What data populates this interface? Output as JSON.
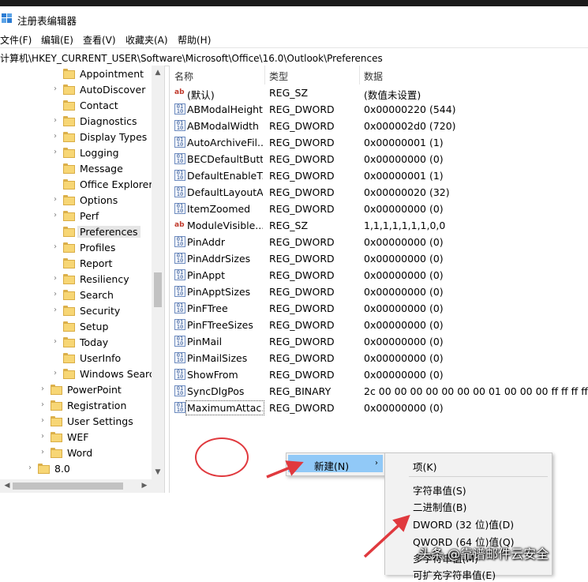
{
  "window": {
    "title": "注册表编辑器"
  },
  "menu": [
    "文件(F)",
    "编辑(E)",
    "查看(V)",
    "收藏夹(A)",
    "帮助(H)"
  ],
  "address": "计算机\\HKEY_CURRENT_USER\\Software\\Microsoft\\Office\\16.0\\Outlook\\Preferences",
  "tree": [
    {
      "label": "Appointment",
      "level": 2,
      "expandable": false
    },
    {
      "label": "AutoDiscover",
      "level": 2,
      "expandable": true
    },
    {
      "label": "Contact",
      "level": 2,
      "expandable": false
    },
    {
      "label": "Diagnostics",
      "level": 2,
      "expandable": true
    },
    {
      "label": "Display Types",
      "level": 2,
      "expandable": true
    },
    {
      "label": "Logging",
      "level": 2,
      "expandable": true
    },
    {
      "label": "Message",
      "level": 2,
      "expandable": false
    },
    {
      "label": "Office Explorer",
      "level": 2,
      "expandable": false
    },
    {
      "label": "Options",
      "level": 2,
      "expandable": true
    },
    {
      "label": "Perf",
      "level": 2,
      "expandable": true
    },
    {
      "label": "Preferences",
      "level": 2,
      "expandable": false,
      "selected": true
    },
    {
      "label": "Profiles",
      "level": 2,
      "expandable": true
    },
    {
      "label": "Report",
      "level": 2,
      "expandable": false
    },
    {
      "label": "Resiliency",
      "level": 2,
      "expandable": true
    },
    {
      "label": "Search",
      "level": 2,
      "expandable": true
    },
    {
      "label": "Security",
      "level": 2,
      "expandable": true
    },
    {
      "label": "Setup",
      "level": 2,
      "expandable": false
    },
    {
      "label": "Today",
      "level": 2,
      "expandable": true
    },
    {
      "label": "UserInfo",
      "level": 2,
      "expandable": false
    },
    {
      "label": "Windows Search",
      "level": 2,
      "expandable": true
    },
    {
      "label": "PowerPoint",
      "level": 1,
      "expandable": true
    },
    {
      "label": "Registration",
      "level": 1,
      "expandable": true
    },
    {
      "label": "User Settings",
      "level": 1,
      "expandable": true
    },
    {
      "label": "WEF",
      "level": 1,
      "expandable": true
    },
    {
      "label": "Word",
      "level": 1,
      "expandable": true
    },
    {
      "label": "8.0",
      "level": 0,
      "expandable": true
    }
  ],
  "columns": {
    "name": "名称",
    "type": "类型",
    "data": "数据"
  },
  "values": [
    {
      "name": "(默认)",
      "type": "REG_SZ",
      "data": "(数值未设置)",
      "icon": "string"
    },
    {
      "name": "ABModalHeight",
      "type": "REG_DWORD",
      "data": "0x00000220 (544)",
      "icon": "binary"
    },
    {
      "name": "ABModalWidth",
      "type": "REG_DWORD",
      "data": "0x000002d0 (720)",
      "icon": "binary"
    },
    {
      "name": "AutoArchiveFil...",
      "type": "REG_DWORD",
      "data": "0x00000001 (1)",
      "icon": "binary"
    },
    {
      "name": "BECDefaultButt...",
      "type": "REG_DWORD",
      "data": "0x00000000 (0)",
      "icon": "binary"
    },
    {
      "name": "DefaultEnableT...",
      "type": "REG_DWORD",
      "data": "0x00000001 (1)",
      "icon": "binary"
    },
    {
      "name": "DefaultLayoutA...",
      "type": "REG_DWORD",
      "data": "0x00000020 (32)",
      "icon": "binary"
    },
    {
      "name": "ItemZoomed",
      "type": "REG_DWORD",
      "data": "0x00000000 (0)",
      "icon": "binary"
    },
    {
      "name": "ModuleVisible...",
      "type": "REG_SZ",
      "data": "1,1,1,1,1,1,1,0,0",
      "icon": "string"
    },
    {
      "name": "PinAddr",
      "type": "REG_DWORD",
      "data": "0x00000000 (0)",
      "icon": "binary"
    },
    {
      "name": "PinAddrSizes",
      "type": "REG_DWORD",
      "data": "0x00000000 (0)",
      "icon": "binary"
    },
    {
      "name": "PinAppt",
      "type": "REG_DWORD",
      "data": "0x00000000 (0)",
      "icon": "binary"
    },
    {
      "name": "PinApptSizes",
      "type": "REG_DWORD",
      "data": "0x00000000 (0)",
      "icon": "binary"
    },
    {
      "name": "PinFTree",
      "type": "REG_DWORD",
      "data": "0x00000000 (0)",
      "icon": "binary"
    },
    {
      "name": "PinFTreeSizes",
      "type": "REG_DWORD",
      "data": "0x00000000 (0)",
      "icon": "binary"
    },
    {
      "name": "PinMail",
      "type": "REG_DWORD",
      "data": "0x00000000 (0)",
      "icon": "binary"
    },
    {
      "name": "PinMailSizes",
      "type": "REG_DWORD",
      "data": "0x00000000 (0)",
      "icon": "binary"
    },
    {
      "name": "ShowFrom",
      "type": "REG_DWORD",
      "data": "0x00000000 (0)",
      "icon": "binary"
    },
    {
      "name": "SyncDlgPos",
      "type": "REG_BINARY",
      "data": "2c 00 00 00 00 00 00 00 01 00 00 00 ff ff ff ff f...",
      "icon": "binary"
    },
    {
      "name": "MaximumAttac...",
      "type": "REG_DWORD",
      "data": "0x00000000 (0)",
      "icon": "binary",
      "focused": true
    }
  ],
  "context_menu": {
    "new_label": "新建(N)",
    "submenu": [
      {
        "label": "项(K)"
      },
      {
        "label": "字符串值(S)"
      },
      {
        "label": "二进制值(B)"
      },
      {
        "label": "DWORD (32 位)值(D)"
      },
      {
        "label": "QWORD (64 位)值(Q)"
      },
      {
        "label": "多字符串值(M)"
      },
      {
        "label": "可扩充字符串值(E)"
      }
    ]
  },
  "watermark": "头条 @靠谱邮件云安全",
  "colors": {
    "annotation": "#e0393e",
    "menu_highlight": "#91c9f7",
    "folder": "#f7d675"
  }
}
